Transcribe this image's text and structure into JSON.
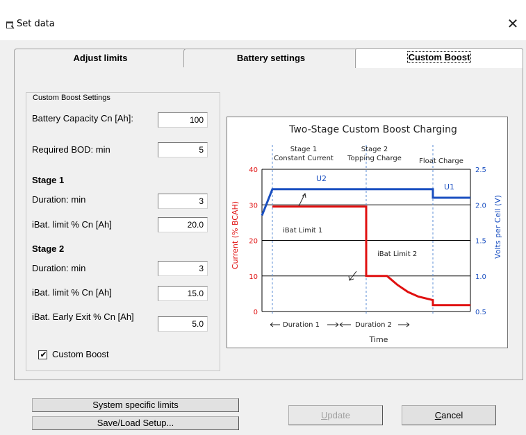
{
  "window": {
    "title": "Set data",
    "close_glyph": "✕"
  },
  "tabs": [
    {
      "label": "Adjust limits"
    },
    {
      "label": "Battery settings"
    },
    {
      "label": "Custom Boost"
    }
  ],
  "group": {
    "legend": "Custom Boost Settings",
    "battery_capacity": {
      "label": "Battery Capacity Cn [Ah]:",
      "value": "100"
    },
    "required_bod": {
      "label": "Required BOD: min",
      "value": "5"
    },
    "stage1": {
      "heading": "Stage 1",
      "duration": {
        "label": "Duration: min",
        "value": "3"
      },
      "ibat_limit": {
        "label": "iBat. limit % Cn [Ah]",
        "value": "20.0"
      }
    },
    "stage2": {
      "heading": "Stage 2",
      "duration": {
        "label": "Duration: min",
        "value": "3"
      },
      "ibat_limit": {
        "label": "iBat. limit % Cn [Ah]",
        "value": "15.0"
      },
      "early_exit": {
        "label": "iBat. Early Exit % Cn [Ah]",
        "value": "5.0"
      }
    },
    "custom_boost_checkbox": {
      "label": "Custom Boost",
      "checked": true,
      "mark": "✔"
    }
  },
  "chart_data": {
    "type": "line",
    "title": "Two-Stage Custom Boost Charging",
    "xlabel": "Time",
    "ylabel_left": "Current (% BCAH)",
    "ylabel_right": "Volts per Cell (V)",
    "left_axis": {
      "ylim": [
        0,
        40
      ],
      "ticks": [
        "0",
        "10",
        "20",
        "30",
        "40"
      ],
      "color": "#e01010"
    },
    "right_axis": {
      "ylim": [
        0.5,
        2.5
      ],
      "ticks": [
        "0.5",
        "1.0",
        "1.5",
        "2.0",
        "2.5"
      ],
      "color": "#1a4fc0"
    },
    "phase_labels": [
      {
        "line1": "Stage 1",
        "line2": "Constant Current"
      },
      {
        "line1": "Stage 2",
        "line2": "Topping Charge"
      },
      {
        "line1": "",
        "line2": "Float Charge"
      }
    ],
    "duration_labels": [
      "Duration 1",
      "Duration 2"
    ],
    "annotations": [
      "iBat Limit 1",
      "iBat Limit 2"
    ],
    "voltage_labels": [
      "U2",
      "U1"
    ],
    "phase_boundaries": [
      0.05,
      0.5,
      0.82
    ],
    "series": [
      {
        "color": "#e01010",
        "points": [
          [
            0.05,
            29.5
          ],
          [
            0.5,
            29.5
          ],
          [
            0.5,
            10
          ],
          [
            0.6,
            10
          ],
          [
            0.65,
            7.5
          ],
          [
            0.7,
            5.5
          ],
          [
            0.75,
            4.2
          ],
          [
            0.82,
            3.2
          ],
          [
            0.82,
            1.8
          ],
          [
            1.0,
            1.8
          ]
        ]
      },
      {
        "color": "#1a4fc0",
        "points": [
          [
            0.0,
            1.85
          ],
          [
            0.05,
            2.22
          ],
          [
            0.82,
            2.22
          ],
          [
            0.82,
            2.1
          ],
          [
            1.0,
            2.1
          ]
        ]
      }
    ]
  },
  "buttons": {
    "system_specific_limits": "System specific limits",
    "save_load_setup": "Save/Load Setup...",
    "update": {
      "u": "U",
      "rest": "pdate"
    },
    "cancel": {
      "u": "C",
      "rest": "ancel"
    }
  }
}
